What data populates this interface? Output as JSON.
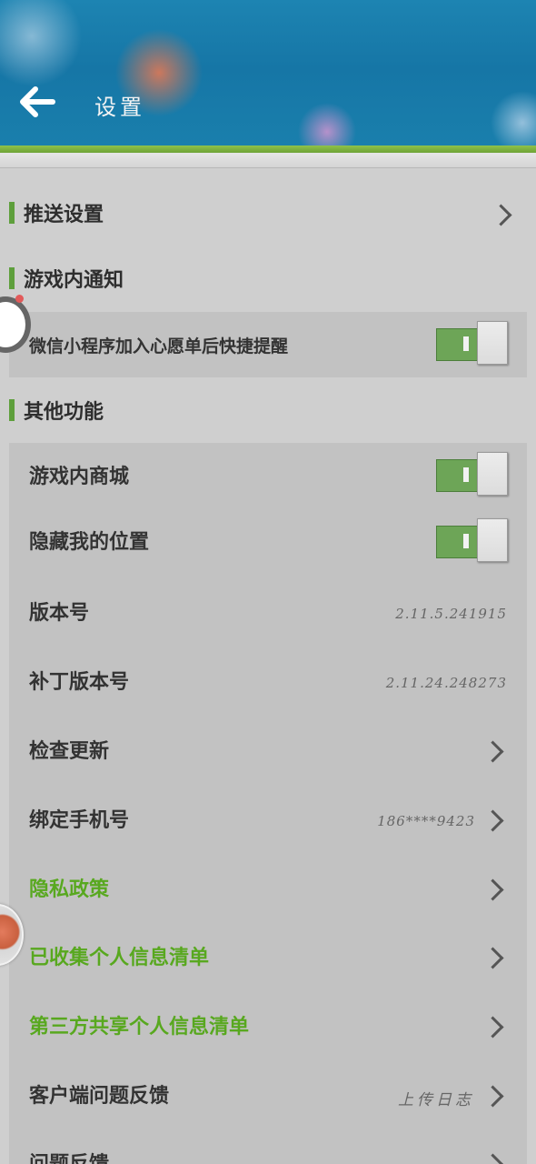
{
  "header": {
    "title": "设置"
  },
  "sections": {
    "push": {
      "label": "推送设置"
    },
    "in_game_notice": {
      "title": "游戏内通知",
      "wishlist_reminder": {
        "label": "微信小程序加入心愿单后快捷提醒",
        "enabled": true
      }
    },
    "other": {
      "title": "其他功能",
      "in_game_store": {
        "label": "游戏内商城",
        "enabled": true
      },
      "hide_location": {
        "label": "隐藏我的位置",
        "enabled": true
      },
      "version": {
        "label": "版本号",
        "value": "2.11.5.241915"
      },
      "patch_version": {
        "label": "补丁版本号",
        "value": "2.11.24.248273"
      },
      "check_update": {
        "label": "检查更新"
      },
      "bind_phone": {
        "label": "绑定手机号",
        "value": "186****9423"
      },
      "privacy_policy": {
        "label": "隐私政策"
      },
      "collected_info": {
        "label": "已收集个人信息清单"
      },
      "third_party_info": {
        "label": "第三方共享个人信息清单"
      },
      "client_feedback": {
        "label": "客户端问题反馈",
        "value": "上传日志"
      },
      "feedback": {
        "label": "问题反馈"
      }
    }
  },
  "colors": {
    "accent_green": "#58a81f",
    "toggle_on": "#6da557",
    "header_blue": "#1676a6"
  }
}
